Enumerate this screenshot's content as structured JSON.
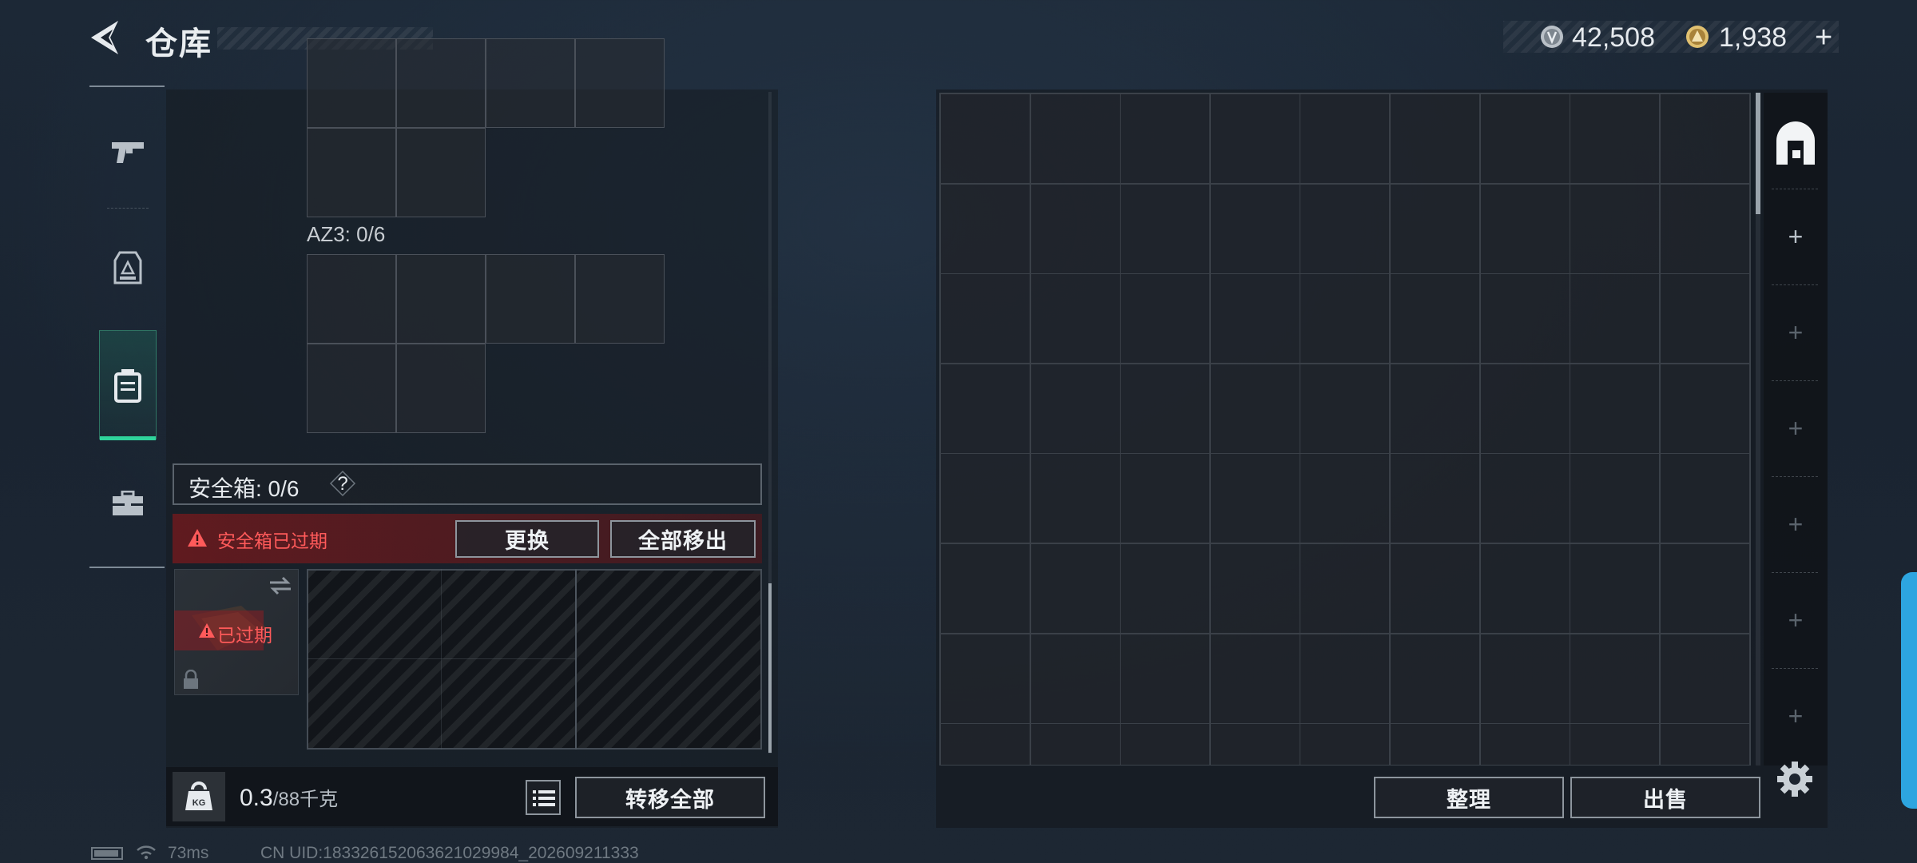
{
  "header": {
    "title": "仓库",
    "currency_silver": "42,508",
    "currency_gold": "1,938",
    "add_symbol": "+"
  },
  "left_nav": {
    "items": [
      {
        "name": "weapons",
        "icon": "pistol-icon",
        "active": false
      },
      {
        "name": "gear",
        "icon": "vest-icon",
        "active": false
      },
      {
        "name": "backpack",
        "icon": "backpack-icon",
        "active": true
      },
      {
        "name": "toolbox",
        "icon": "briefcase-icon",
        "active": false
      }
    ]
  },
  "container": {
    "az3_label": "AZ3: 0/6"
  },
  "safe_box": {
    "title": "安全箱:  0/6",
    "help": "?",
    "expired_notice": "安全箱已过期",
    "replace_button": "更换",
    "remove_all_button": "全部移出",
    "case_status": "已过期"
  },
  "weight": {
    "current": "0.3",
    "max": "/88千克",
    "transfer_all_button": "转移全部"
  },
  "stash": {
    "tab_icon": "stash-icon",
    "tab_add": "+",
    "sort_button": "整理",
    "sell_button": "出售"
  },
  "status_bar": {
    "ping": "73ms",
    "uid": "CN UID:18332615206362102998​4_202609211333"
  },
  "colors": {
    "accent_green": "#2fd39b",
    "alert_red": "#ff5a5a",
    "side_handle": "#2da5e0"
  }
}
